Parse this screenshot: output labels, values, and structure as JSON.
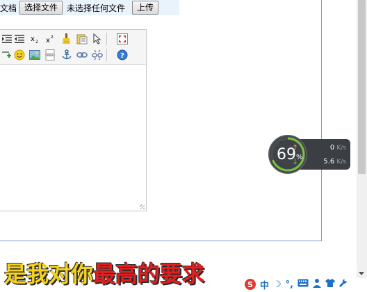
{
  "upload": {
    "label": "文档",
    "choose_button": "选择文件",
    "no_file_text": "未选择任何文件",
    "upload_button": "上传"
  },
  "net_monitor": {
    "percent": "69",
    "percent_unit": "%",
    "up_value": "0",
    "up_unit": "K/s",
    "down_value": "5.6",
    "down_unit": "K/s"
  },
  "lyric": {
    "part1": "是我对你",
    "part2": "最高的要求"
  },
  "ime": {
    "lang": "中"
  },
  "colors": {
    "frame": "#7a9cc6",
    "lyric_yellow": "#f7d21a",
    "lyric_red": "#e02020",
    "ime_blue": "#1a73c8"
  }
}
